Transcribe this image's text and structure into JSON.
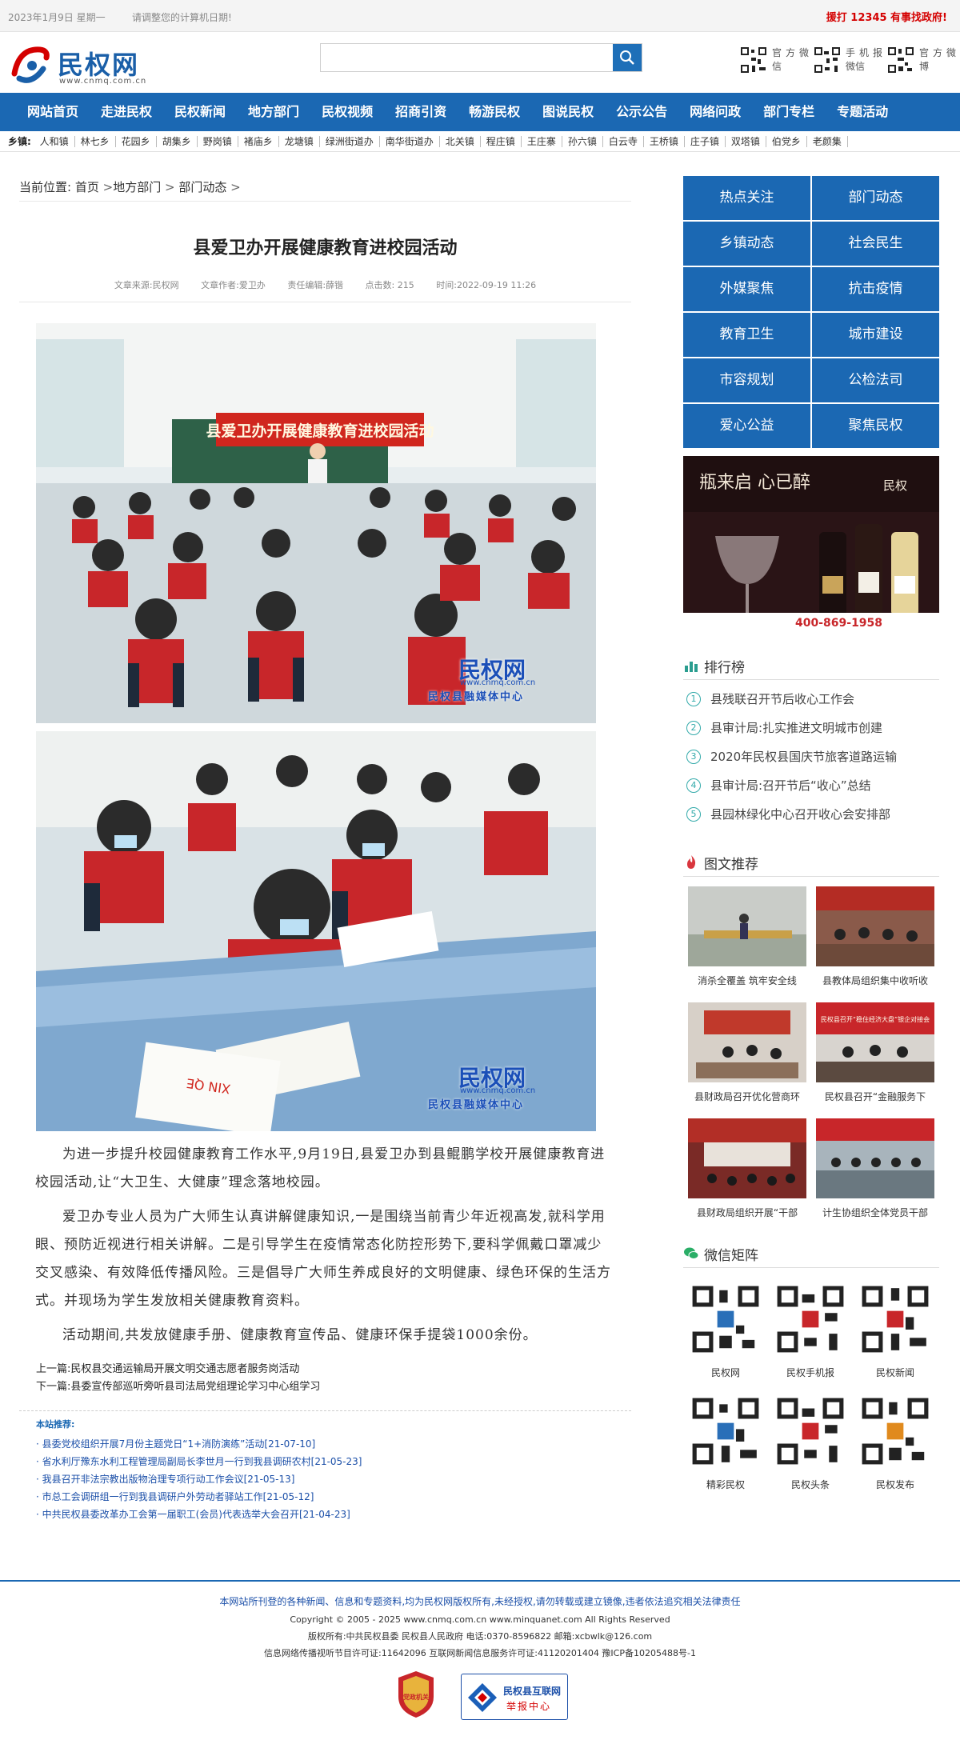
{
  "topbar": {
    "date": "2023年1月9日 星期一",
    "notice": "请调整您的计算机日期!",
    "hotline": "援打 12345 有事找政府!"
  },
  "header": {
    "logo_text": "民权网",
    "logo_url": "www.cnmq.com.cn",
    "search_placeholder": "",
    "qr": [
      {
        "label": "官方微信"
      },
      {
        "label": "手机报微信"
      },
      {
        "label": "官方微博"
      }
    ]
  },
  "nav": [
    "网站首页",
    "走进民权",
    "民权新闻",
    "地方部门",
    "民权视频",
    "招商引资",
    "畅游民权",
    "图说民权",
    "公示公告",
    "网络问政",
    "部门专栏",
    "专题活动"
  ],
  "towns": {
    "label": "乡镇:",
    "items": [
      "人和镇",
      "林七乡",
      "花园乡",
      "胡集乡",
      "野岗镇",
      "褚庙乡",
      "龙塘镇",
      "绿洲街道办",
      "南华街道办",
      "北关镇",
      "程庄镇",
      "王庄寨",
      "孙六镇",
      "白云寺",
      "王桥镇",
      "庄子镇",
      "双塔镇",
      "伯党乡",
      "老颜集"
    ]
  },
  "breadcrumb": {
    "prefix": "当前位置:",
    "home": "首页",
    "l2": "地方部门",
    "l3": "部门动态",
    "sep": ">"
  },
  "article": {
    "title": "县爱卫办开展健康教育进校园活动",
    "meta": {
      "source": "文章来源:民权网",
      "author": "文章作者:爱卫办",
      "editor": "责任编辑:薛锴",
      "clicks": "点击数: 215",
      "time": "时间:2022-09-19 11:26"
    },
    "banner": "县爱卫办开展健康教育进校园活动",
    "watermark": {
      "name": "民权网",
      "url": "www.cnmq.com.cn",
      "sub": "民权县融媒体中心"
    },
    "book_text": "XIN QE",
    "paragraphs": [
      "为进一步提升校园健康教育工作水平,9月19日,县爱卫办到县鲲鹏学校开展健康教育进校园活动,让“大卫生、大健康”理念落地校园。",
      "爱卫办专业人员为广大师生认真讲解健康知识,一是围绕当前青少年近视高发,就科学用眼、预防近视进行相关讲解。二是引导学生在疫情常态化防控形势下,要科学佩戴口罩减少交叉感染、有效降低传播风险。三是倡导广大师生养成良好的文明健康、绿色环保的生活方式。并现场为学生发放相关健康教育资料。",
      "活动期间,共发放健康手册、健康教育宣传品、健康环保手提袋1000余份。"
    ],
    "prev": "上一篇:民权县交通运输局开展文明交通志愿者服务岗活动",
    "next": "下一篇:县委宣传部巡听旁听县司法局党组理论学习中心组学习"
  },
  "recommend": {
    "title": "本站推荐:",
    "items": [
      "· 县委党校组织开展7月份主题党日“1+消防演练”活动[21-07-10]",
      "· 省水利厅豫东水利工程管理局副局长李世月一行到我县调研农村[21-05-23]",
      "· 我县召开非法宗教出版物治理专项行动工作会议[21-05-13]",
      "· 市总工会调研组一行到我县调研户外劳动者驿站工作[21-05-12]",
      "· 中共民权县委改革办工会第一届职工(会员)代表选举大会召开[21-04-23]"
    ]
  },
  "sidebar": {
    "categories": [
      "热点关注",
      "部门动态",
      "乡镇动态",
      "社会民生",
      "外媒聚焦",
      "抗击疫情",
      "教育卫生",
      "城市建设",
      "市容规划",
      "公检法司",
      "爱心公益",
      "聚焦民权"
    ],
    "ad": {
      "slogan": "瓶来启 心已醉",
      "brand": "民权",
      "phone": "400-869-1958"
    },
    "rank_title": "排行榜",
    "rank": [
      "县残联召开节后收心工作会",
      "县审计局:扎实推进文明城市创建",
      "2020年民权县国庆节旅客道路运输",
      "县审计局:召开节后“收心”总结",
      "县园林绿化中心召开收心会安排部"
    ],
    "pics_title": "图文推荐",
    "pics": [
      "消杀全覆盖 筑牢安全线",
      "县教体局组织集中收听收",
      "县财政局召开优化营商环",
      "民权县召开“金融服务下",
      "县财政局组织开展“干部",
      "计生协组织全体党员干部"
    ],
    "pic_banner_3": "民权县召开“稳住经济大盘”银企对接会",
    "wx_title": "微信矩阵",
    "wx": [
      "民权网",
      "民权手机报",
      "民权新闻",
      "精彩民权",
      "民权头条",
      "民权发布"
    ]
  },
  "footer": {
    "line1": "本网站所刊登的各种新闻、信息和专题资料,均为民权网版权所有,未经授权,请勿转载或建立镜像,违者依法追究相关法律责任",
    "line2": "Copyright © 2005 - 2025 www.cnmq.com.cn www.minquanet.com All Rights Reserved",
    "line3": "版权所有:中共民权县委 民权县人民政府 电话:0370-8596822 邮箱:xcbwlk@126.com",
    "line4": "信息网络传播视听节目许可证:11642096 互联网新闻信息服务许可证:41120201404 豫ICP备10205488号-1",
    "badge1": "党政机关",
    "badge2_t1": "民权县互联网",
    "badge2_t2": "举报中心"
  },
  "colors": {
    "nav": "#1b68b3",
    "hot": "#d40000"
  }
}
